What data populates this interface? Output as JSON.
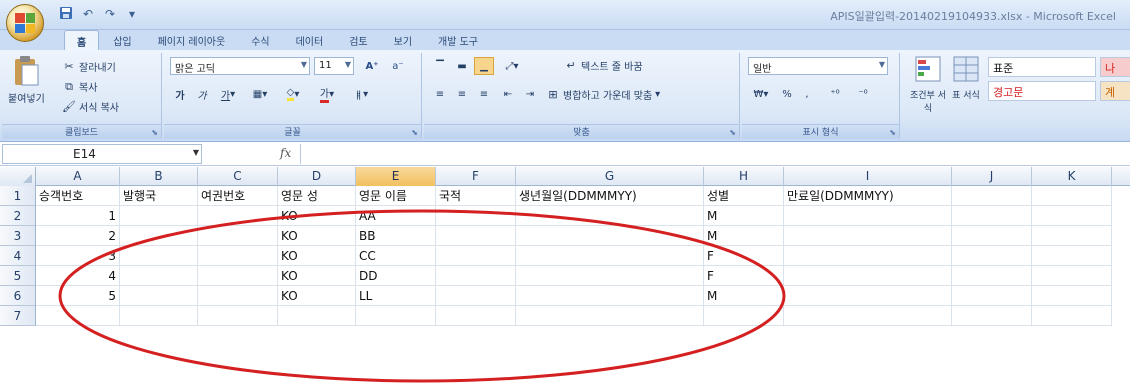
{
  "window": {
    "title": "APIS일괄입력-20140219104933.xlsx - Microsoft Excel"
  },
  "quick_access": {
    "save_icon": "save-icon",
    "undo_icon": "undo-icon",
    "redo_icon": "redo-icon",
    "dropdown_icon": "chevron-down-icon"
  },
  "tabs": [
    {
      "label": "홈"
    },
    {
      "label": "삽입"
    },
    {
      "label": "페이지 레이아웃"
    },
    {
      "label": "수식"
    },
    {
      "label": "데이터"
    },
    {
      "label": "검토"
    },
    {
      "label": "보기"
    },
    {
      "label": "개발 도구"
    }
  ],
  "clipboard": {
    "paste": "붙여넣기",
    "cut": "잘라내기",
    "copy": "복사",
    "format_painter": "서식 복사",
    "label": "클립보드"
  },
  "font": {
    "name": "맑은 고딕",
    "size": "11",
    "label": "글꼴"
  },
  "alignment": {
    "wrap_text": "텍스트 줄 바꿈",
    "merge_center": "병합하고 가운데 맞춤",
    "label": "맞춤"
  },
  "number": {
    "format": "일반",
    "label": "표시 형식"
  },
  "styles": {
    "conditional": "조건부 서식",
    "table": "표 서식",
    "normal": "표준",
    "warning": "경고문",
    "right_1": "나",
    "right_2": "계"
  },
  "formula_bar": {
    "name_box": "E14",
    "fx": "fx",
    "value": ""
  },
  "columns": [
    {
      "label": "A",
      "selected": false
    },
    {
      "label": "B",
      "selected": false
    },
    {
      "label": "C",
      "selected": false
    },
    {
      "label": "D",
      "selected": false
    },
    {
      "label": "E",
      "selected": true
    },
    {
      "label": "F",
      "selected": false
    },
    {
      "label": "G",
      "selected": false
    },
    {
      "label": "H",
      "selected": false
    },
    {
      "label": "I",
      "selected": false
    },
    {
      "label": "J",
      "selected": false
    },
    {
      "label": "K",
      "selected": false
    }
  ],
  "rows": [
    {
      "num": "1",
      "cells": [
        "승객번호",
        "발행국",
        "여권번호",
        "영문 성",
        "영문 이름",
        "국적",
        "생년월일(DDMMMYY)",
        "성별",
        "만료일(DDMMMYY)",
        "",
        ""
      ]
    },
    {
      "num": "2",
      "cells": [
        "1",
        "",
        "",
        "KO",
        "AA",
        "",
        "",
        "M",
        "",
        "",
        ""
      ]
    },
    {
      "num": "3",
      "cells": [
        "2",
        "",
        "",
        "KO",
        "BB",
        "",
        "",
        "M",
        "",
        "",
        ""
      ]
    },
    {
      "num": "4",
      "cells": [
        "3",
        "",
        "",
        "KO",
        "CC",
        "",
        "",
        "F",
        "",
        "",
        ""
      ]
    },
    {
      "num": "5",
      "cells": [
        "4",
        "",
        "",
        "KO",
        "DD",
        "",
        "",
        "F",
        "",
        "",
        ""
      ]
    },
    {
      "num": "6",
      "cells": [
        "5",
        "",
        "",
        "KO",
        "LL",
        "",
        "",
        "M",
        "",
        "",
        ""
      ]
    },
    {
      "num": "7",
      "cells": [
        "",
        "",
        "",
        "",
        "",
        "",
        "",
        "",
        "",
        "",
        ""
      ]
    }
  ],
  "colors": {
    "annotation": "#d42020",
    "selected_header": "#f1c15f"
  }
}
